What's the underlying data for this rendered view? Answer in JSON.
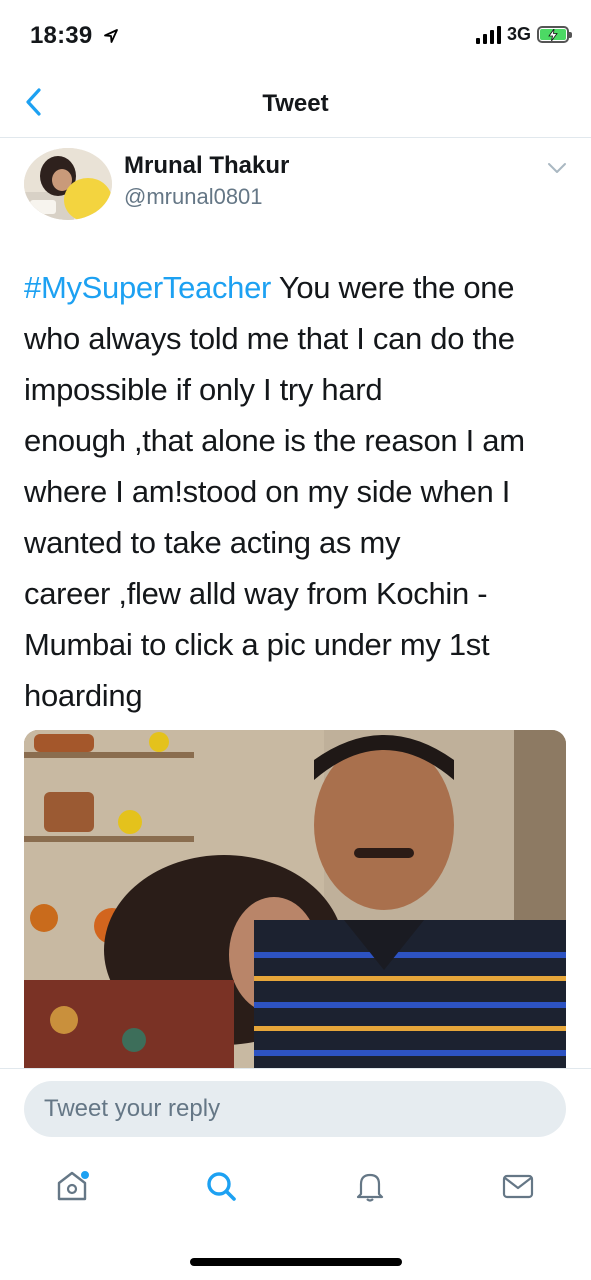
{
  "status_bar": {
    "time": "18:39",
    "network": "3G",
    "icons": [
      "location-arrow-icon",
      "signal-bars-icon",
      "battery-charging-icon"
    ]
  },
  "nav": {
    "title": "Tweet",
    "back_icon": "chevron-left-icon"
  },
  "tweet": {
    "author_name": "Mrunal Thakur",
    "author_handle": "@mrunal0801",
    "hashtag": "#MySuperTeacher",
    "text_lines": [
      " You were the one",
      "who always told me that I can do the",
      "impossible if only I try hard",
      "enough ,that alone is the reason I am",
      "where I am!stood on my side when I",
      "wanted to take acting as my",
      "career ,flew alld way from Kochin -",
      "Mumbai to click a pic under my 1st",
      "hoarding"
    ],
    "photo_icon": "tweet-photo"
  },
  "reply": {
    "placeholder": "Tweet your reply",
    "value": ""
  },
  "tab_bar": {
    "items": [
      {
        "name": "home",
        "icon": "home-icon",
        "has_badge": true
      },
      {
        "name": "search",
        "icon": "search-icon",
        "active": true
      },
      {
        "name": "notifications",
        "icon": "bell-icon"
      },
      {
        "name": "messages",
        "icon": "envelope-icon"
      }
    ]
  },
  "colors": {
    "accent": "#1da1f2",
    "text_primary": "#14171a",
    "text_secondary": "#657786",
    "divider": "#e1e8ed",
    "input_bg": "#e6ecf0",
    "battery": "#4cd964"
  }
}
